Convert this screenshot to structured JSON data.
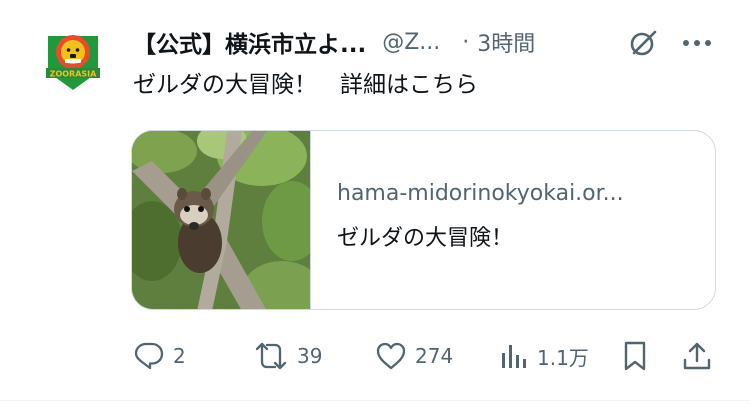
{
  "tweet": {
    "display_name": "【公式】横浜市立よ...",
    "handle": "@Z...",
    "separator": "·",
    "time": "3時間",
    "text": "ゼルダの大冒険！　詳細はこちら",
    "avatar_label": "ZOORASIA"
  },
  "card": {
    "domain": "hama-midorinokyokai.or...",
    "title": "ゼルダの大冒険！"
  },
  "actions": {
    "reply_count": "2",
    "retweet_count": "39",
    "like_count": "274",
    "views_count": "1.1万"
  },
  "icons": {
    "reply": "reply-icon",
    "retweet": "retweet-icon",
    "like": "heart-icon",
    "views": "views-icon",
    "bookmark": "bookmark-icon",
    "share": "share-icon",
    "grok": "grok-icon",
    "more": "more-icon"
  },
  "colors": {
    "text": "#0f1419",
    "secondary": "#536471",
    "border": "#cfd9de",
    "avatar_green": "#1f9a3a",
    "avatar_yellow": "#f2c21a"
  }
}
